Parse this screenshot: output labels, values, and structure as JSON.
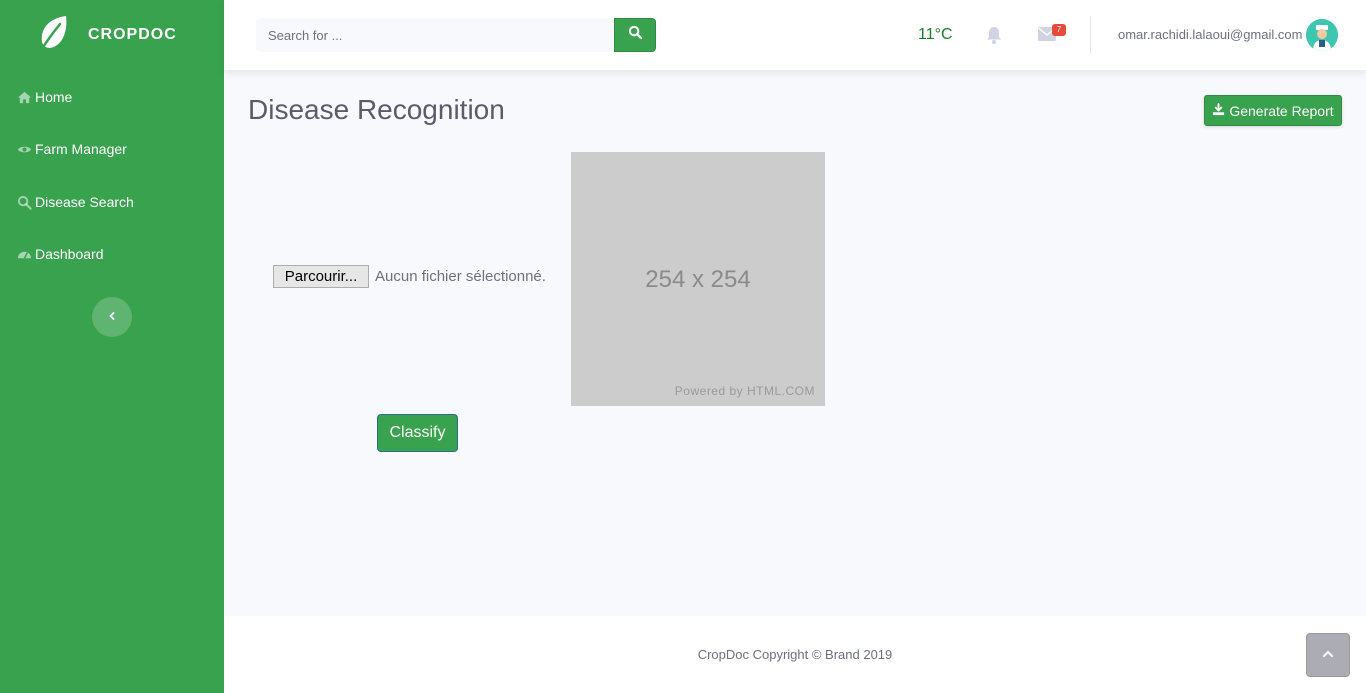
{
  "brand": {
    "name": "CROPDOC",
    "logo_icon": "leaf-icon"
  },
  "sidebar": {
    "items": [
      {
        "label": "Home",
        "icon": "home-icon"
      },
      {
        "label": "Farm Manager",
        "icon": "eye-icon"
      },
      {
        "label": "Disease Search",
        "icon": "search-icon"
      },
      {
        "label": "Dashboard",
        "icon": "dashboard-icon"
      }
    ],
    "toggle_icon": "chevron-left-icon"
  },
  "topbar": {
    "search_placeholder": "Search for ...",
    "temperature": "11°C",
    "mail_count": "7",
    "user_email": "omar.rachidi.lalaoui@gmail.com"
  },
  "main": {
    "title": "Disease Recognition",
    "generate_report_label": "Generate Report",
    "file_button_label": "Parcourir...",
    "file_status": "Aucun fichier sélectionné.",
    "preview_dims": "254 x 254",
    "preview_powered": "Powered by HTML.COM",
    "classify_label": "Classify"
  },
  "footer": {
    "text": "CropDoc Copyright © Brand 2019"
  },
  "colors": {
    "primary": "#39a24f",
    "temperature": "#1e7a2e",
    "badge": "#e74a3b"
  }
}
